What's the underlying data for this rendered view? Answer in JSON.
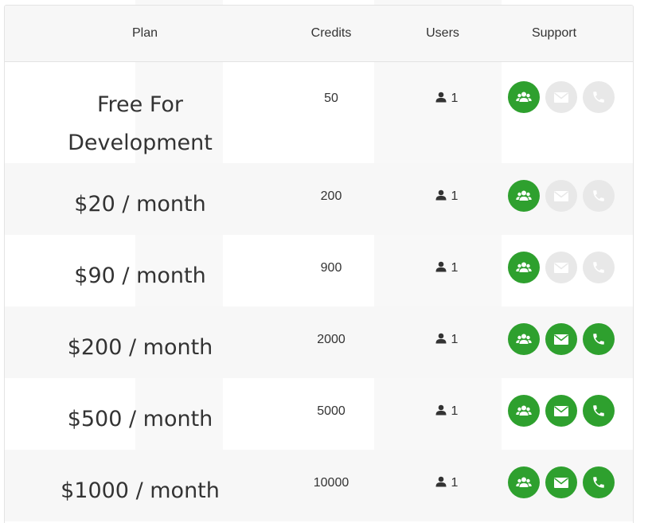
{
  "table": {
    "headers": {
      "plan": "Plan",
      "credits": "Credits",
      "users": "Users",
      "support": "Support"
    },
    "colors": {
      "support_on": "#2ea02e",
      "support_off": "#e8e8e8"
    },
    "rows": [
      {
        "plan_line1": "Free For",
        "plan_line2": "Development",
        "credits": "50",
        "users": "1",
        "support": {
          "community": true,
          "email": false,
          "phone": false
        }
      },
      {
        "plan": "$20 / month",
        "credits": "200",
        "users": "1",
        "support": {
          "community": true,
          "email": false,
          "phone": false
        }
      },
      {
        "plan": "$90 / month",
        "credits": "900",
        "users": "1",
        "support": {
          "community": true,
          "email": false,
          "phone": false
        }
      },
      {
        "plan": "$200 / month",
        "credits": "2000",
        "users": "1",
        "support": {
          "community": true,
          "email": true,
          "phone": true
        }
      },
      {
        "plan": "$500 / month",
        "credits": "5000",
        "users": "1",
        "support": {
          "community": true,
          "email": true,
          "phone": true
        }
      },
      {
        "plan": "$1000 / month",
        "credits": "10000",
        "users": "1",
        "support": {
          "community": true,
          "email": true,
          "phone": true
        }
      }
    ]
  }
}
